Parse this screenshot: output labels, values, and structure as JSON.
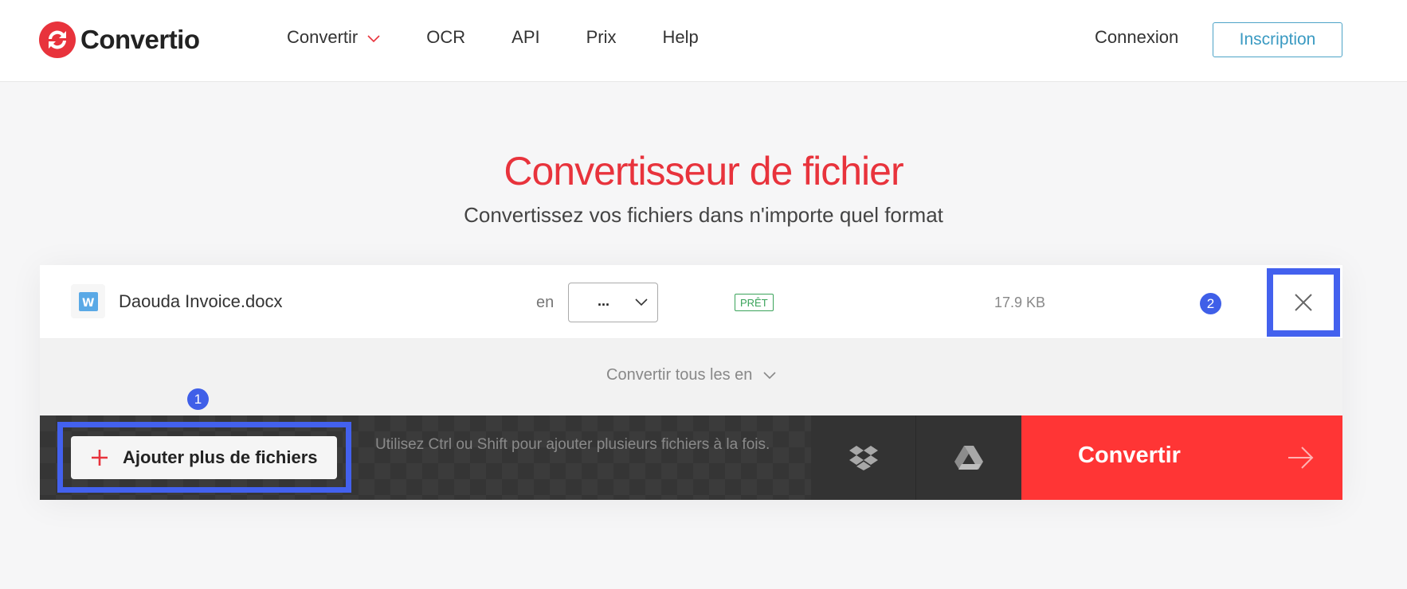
{
  "header": {
    "logo_text": "Convertio",
    "nav": [
      {
        "label": "Convertir",
        "has_dropdown": true
      },
      {
        "label": "OCR"
      },
      {
        "label": "API"
      },
      {
        "label": "Prix"
      },
      {
        "label": "Help"
      }
    ],
    "login_label": "Connexion",
    "signup_label": "Inscription"
  },
  "hero": {
    "title": "Convertisseur de fichier",
    "subtitle": "Convertissez vos fichiers dans n'importe quel format"
  },
  "file": {
    "name": "Daouda Invoice.docx",
    "en_label": "en",
    "format_value": "...",
    "status": "PRÊT",
    "size": "17.9 KB"
  },
  "convert_all_label": "Convertir tous les en",
  "actions": {
    "add_label": "Ajouter plus de fichiers",
    "hint": "Utilisez Ctrl ou Shift pour ajouter plusieurs fichiers à la fois.",
    "convert_label": "Convertir"
  },
  "annotations": {
    "badge_1": "1",
    "badge_2": "2"
  },
  "colors": {
    "brand_red": "#e8333c",
    "convert_red": "#ff3535",
    "highlight_blue": "#4361ee",
    "status_green": "#3aa35a",
    "signup_blue": "#3a9ac2"
  },
  "icons": [
    "convertio-logo-icon",
    "chevron-down-icon",
    "word-file-icon",
    "close-icon",
    "plus-icon",
    "dropbox-icon",
    "google-drive-icon",
    "arrow-right-icon"
  ]
}
